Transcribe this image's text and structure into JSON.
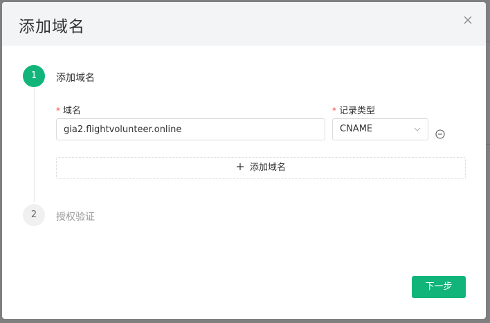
{
  "modal": {
    "title": "添加域名"
  },
  "steps": [
    {
      "number": "1",
      "label": "添加域名"
    },
    {
      "number": "2",
      "label": "授权验证"
    }
  ],
  "form": {
    "domain_label": "域名",
    "domain_value": "gia2.flightvolunteer.online",
    "record_type_label": "记录类型",
    "record_type_value": "CNAME",
    "required_mark": "*"
  },
  "add_domain_label": "添加域名",
  "next_label": "下一步",
  "colors": {
    "accent": "#11b57a",
    "required": "#f05050"
  }
}
